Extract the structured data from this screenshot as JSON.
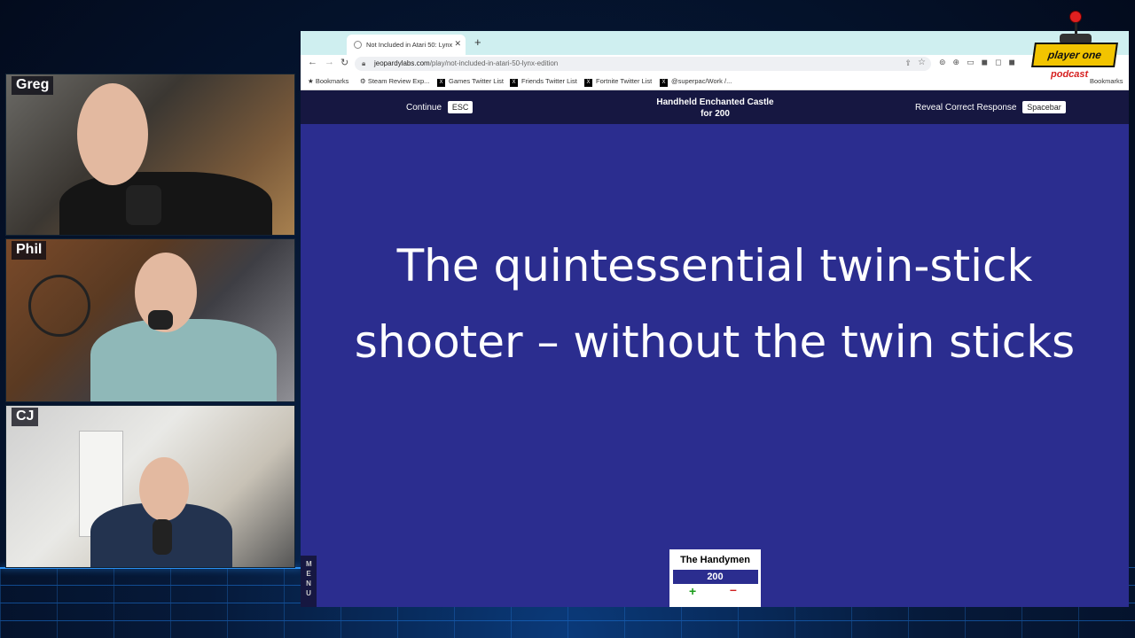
{
  "participants": [
    {
      "name": "Greg"
    },
    {
      "name": "Phil"
    },
    {
      "name": "CJ"
    }
  ],
  "browser": {
    "tab_title": "Not Included in Atari 50: Lynx",
    "new_tab": "+",
    "url_host": "jeopardylabs.com",
    "url_path": "/play/not-included-in-atari-50-lynx-edition",
    "bookmarks": [
      {
        "label": "Bookmarks",
        "icon": "star-icon"
      },
      {
        "label": "Steam Review Exp...",
        "icon": "steam-icon"
      },
      {
        "label": "Games Twitter List",
        "icon": "x-icon"
      },
      {
        "label": "Friends Twitter List",
        "icon": "x-icon"
      },
      {
        "label": "Fortnite Twitter List",
        "icon": "x-icon"
      },
      {
        "label": "@superpac/Work /...",
        "icon": "x-icon"
      }
    ],
    "bookmarks_overflow": "Bookmarks"
  },
  "game": {
    "continue_label": "Continue",
    "continue_key": "ESC",
    "category": "Handheld Enchanted Castle",
    "for_points": "for 200",
    "reveal_label": "Reveal Correct Response",
    "reveal_key": "Spacebar",
    "clue": "The quintessential twin-stick shooter – without the twin sticks",
    "team_name": "The Handymen",
    "team_score": "200",
    "plus": "+",
    "minus": "–",
    "menu": "MENU"
  },
  "logo": {
    "line1": "player one",
    "line2": "podcast"
  },
  "colors": {
    "page_bg": "#2b2d8f",
    "topbar_bg": "#161741",
    "accent_yellow": "#f2c400",
    "accent_red": "#d62020"
  }
}
